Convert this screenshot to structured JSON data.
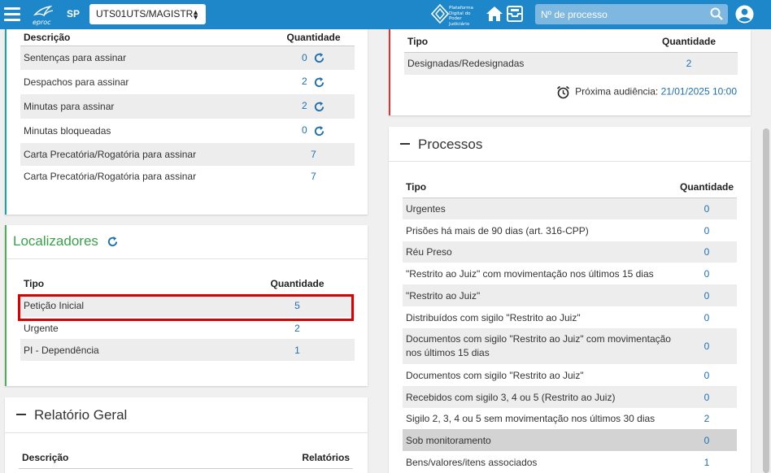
{
  "topbar": {
    "brand": "eproc",
    "state": "SP",
    "unit_select_value": "UTS01UTS/MAGISTR",
    "pdpj_text": "Plataforma Digital do Poder Judiciário",
    "search_placeholder": "Nº de processo"
  },
  "pending": {
    "col_desc": "Descrição",
    "col_qty": "Quantidade",
    "rows": [
      {
        "label": "Sentenças para assinar",
        "qty": "0"
      },
      {
        "label": "Despachos para assinar",
        "qty": "2"
      },
      {
        "label": "Minutas para assinar",
        "qty": "2"
      },
      {
        "label": "Minutas bloqueadas",
        "qty": "0"
      },
      {
        "label": "Carta Precatória/Rogatória para assinar",
        "qty": "7"
      },
      {
        "label": "Carta Precatória/Rogatória para assinar",
        "qty": "7"
      }
    ]
  },
  "localizadores": {
    "title": "Localizadores",
    "col_tipo": "Tipo",
    "col_qty": "Quantidade",
    "rows": [
      {
        "label": "Petição Inicial",
        "qty": "5"
      },
      {
        "label": "Urgente",
        "qty": "2"
      },
      {
        "label": "PI - Dependência",
        "qty": "1"
      }
    ]
  },
  "relatorio": {
    "title": "Relatório Geral",
    "col_desc": "Descrição",
    "col_rel": "Relatórios"
  },
  "audiencias": {
    "col_tipo": "Tipo",
    "col_qty": "Quantidade",
    "rows": [
      {
        "label": "Designadas/Redesignadas",
        "qty": "2"
      }
    ],
    "next_label": "Próxima audiência:",
    "next_value": "21/01/2025 10:00"
  },
  "processos": {
    "title": "Processos",
    "col_tipo": "Tipo",
    "col_qty": "Quantidade",
    "rows": [
      {
        "label": "Urgentes",
        "qty": "0"
      },
      {
        "label": "Prisões há mais de 90 dias (art. 316-CPP)",
        "qty": "0"
      },
      {
        "label": "Réu Preso",
        "qty": "0"
      },
      {
        "label": "\"Restrito ao Juiz\" com movimentação nos últimos 15 dias",
        "qty": "0"
      },
      {
        "label": "\"Restrito ao Juiz\"",
        "qty": "0"
      },
      {
        "label": "Distribuídos com sigilo \"Restrito ao Juiz\"",
        "qty": "0"
      },
      {
        "label": "Documentos com sigilo \"Restrito ao Juiz\" com movimentação nos últimos 15 dias",
        "qty": "0"
      },
      {
        "label": "Documentos com sigilo \"Restrito ao Juiz\"",
        "qty": "0"
      },
      {
        "label": "Recebidos com sigilo 3, 4 ou 5 (Restrito ao Juiz)",
        "qty": "0"
      },
      {
        "label": "Sigilo 2, 3, 4 ou 5 sem movimentação nos últimos 30 dias",
        "qty": "2"
      },
      {
        "label": "Sob monitoramento",
        "qty": "0"
      },
      {
        "label": "Bens/valores/itens associados",
        "qty": "1"
      }
    ]
  },
  "colors": {
    "topbar": "#1e87c9",
    "link": "#1e6fb0",
    "localizadores_title": "#3aa14a",
    "highlight_border": "#dd0000"
  }
}
